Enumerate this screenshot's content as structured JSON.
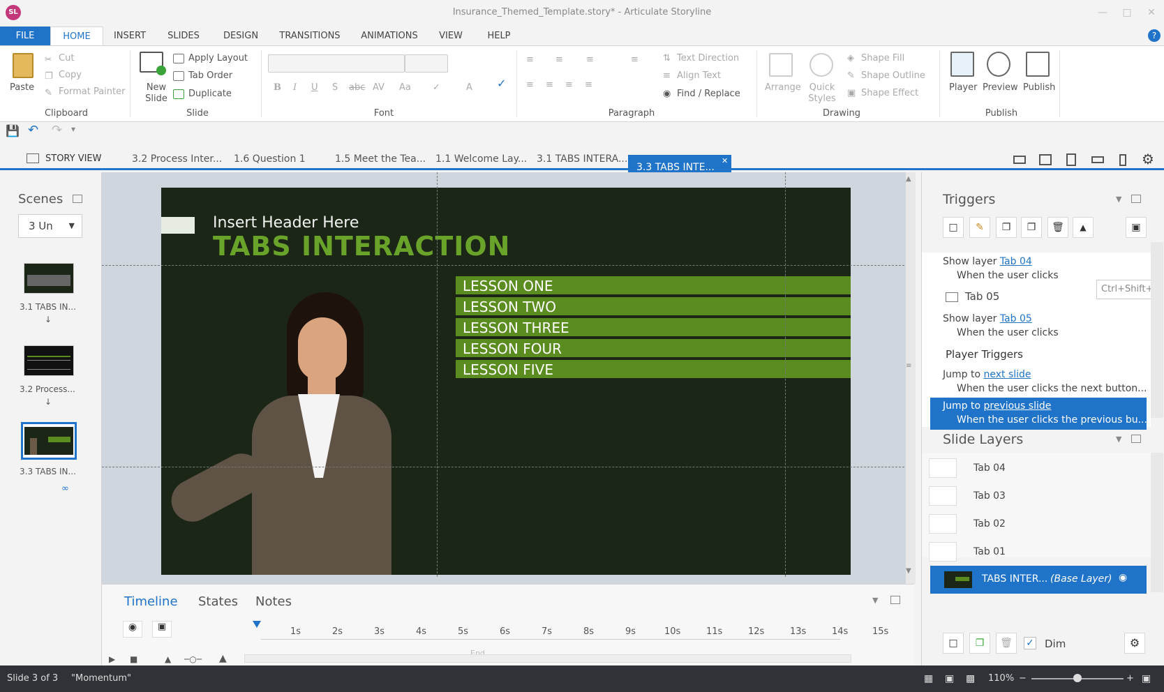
{
  "window": {
    "title": "Insurance_Themed_Template.story* - Articulate Storyline",
    "logo": "SL"
  },
  "ribbon_tabs": [
    "FILE",
    "HOME",
    "INSERT",
    "SLIDES",
    "DESIGN",
    "TRANSITIONS",
    "ANIMATIONS",
    "VIEW",
    "HELP"
  ],
  "clipboard": {
    "paste": "Paste",
    "cut": "Cut",
    "copy": "Copy",
    "format_painter": "Format Painter",
    "title": "Clipboard"
  },
  "slide_group": {
    "new_slide": "New Slide",
    "apply_layout": "Apply Layout",
    "tab_order": "Tab Order",
    "duplicate": "Duplicate",
    "title": "Slide"
  },
  "font_group": {
    "title": "Font"
  },
  "paragraph_group": {
    "text_direction": "Text Direction",
    "align_text": "Align Text",
    "find_replace": "Find / Replace",
    "title": "Paragraph"
  },
  "drawing_group": {
    "arrange": "Arrange",
    "quick_styles": "Quick Styles",
    "shape_fill": "Shape Fill",
    "shape_outline": "Shape Outline",
    "shape_effect": "Shape Effect",
    "title": "Drawing"
  },
  "publish_group": {
    "player": "Player",
    "preview": "Preview",
    "publish": "Publish",
    "title": "Publish"
  },
  "doc_tabs": {
    "story_view": "STORY VIEW",
    "tabs": [
      "3.2 Process Inter...",
      "1.6 Question 1",
      "1.5 Meet the Tea...",
      "1.1 Welcome Lay...",
      "3.1 TABS INTERA..."
    ],
    "active": "3.3 TABS INTE..."
  },
  "scenes": {
    "title": "Scenes",
    "selector": "3 Un",
    "slides": [
      "3.1 TABS IN...",
      "3.2 Process...",
      "3.3 TABS IN..."
    ]
  },
  "slide": {
    "header": "Insert Header Here",
    "title": "TABS INTERACTION",
    "lessons": [
      "LESSON ONE",
      "LESSON  TWO",
      "LESSON THREE",
      "LESSON FOUR",
      "LESSON FIVE"
    ]
  },
  "timeline": {
    "tabs": [
      "Timeline",
      "States",
      "Notes"
    ],
    "ticks": [
      "1s",
      "2s",
      "3s",
      "4s",
      "5s",
      "6s",
      "7s",
      "8s",
      "9s",
      "10s",
      "11s",
      "12s",
      "13s",
      "14s",
      "15s"
    ],
    "end_label": "End"
  },
  "triggers": {
    "title": "Triggers",
    "items": [
      {
        "action": "Show layer",
        "target": "Tab 04",
        "when": "When the user clicks"
      },
      {
        "object": "Tab 05"
      },
      {
        "action": "Show layer",
        "target": "Tab 05",
        "when": "When the user clicks"
      }
    ],
    "player_triggers_title": "Player Triggers",
    "player_triggers": [
      {
        "action": "Jump to",
        "target": "next slide",
        "when": "When the user clicks the next button..."
      },
      {
        "action": "Jump to",
        "target": "previous slide",
        "when": "When the user clicks the previous bu..."
      }
    ],
    "tooltip": "Ctrl+Shift+"
  },
  "slide_layers": {
    "title": "Slide Layers",
    "layers": [
      "Tab 04",
      "Tab 03",
      "Tab 02",
      "Tab 01"
    ],
    "base_layer": {
      "name": "TABS INTER...",
      "label": "(Base Layer)"
    },
    "dim_label": "Dim",
    "dim_checked": true
  },
  "status": {
    "slide": "Slide 3 of 3",
    "theme": "\"Momentum\"",
    "zoom": "110%"
  },
  "colors": {
    "accent": "#1f73c9",
    "slide_bg": "#1b2617",
    "lesson_green": "#5a8c1f",
    "title_green": "#6aa329"
  }
}
